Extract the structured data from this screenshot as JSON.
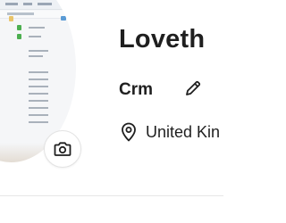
{
  "profile": {
    "name": "Loveth",
    "role": "Crm",
    "location": "United Kin",
    "avatar_icon": "screenshot-thumbnail",
    "camera_icon": "camera-icon",
    "edit_icon": "pencil-icon",
    "location_icon": "location-pin-icon"
  },
  "colors": {
    "text": "#1f1f1f",
    "divider": "#e6e6e6",
    "camera_border": "#e3e3e3"
  }
}
